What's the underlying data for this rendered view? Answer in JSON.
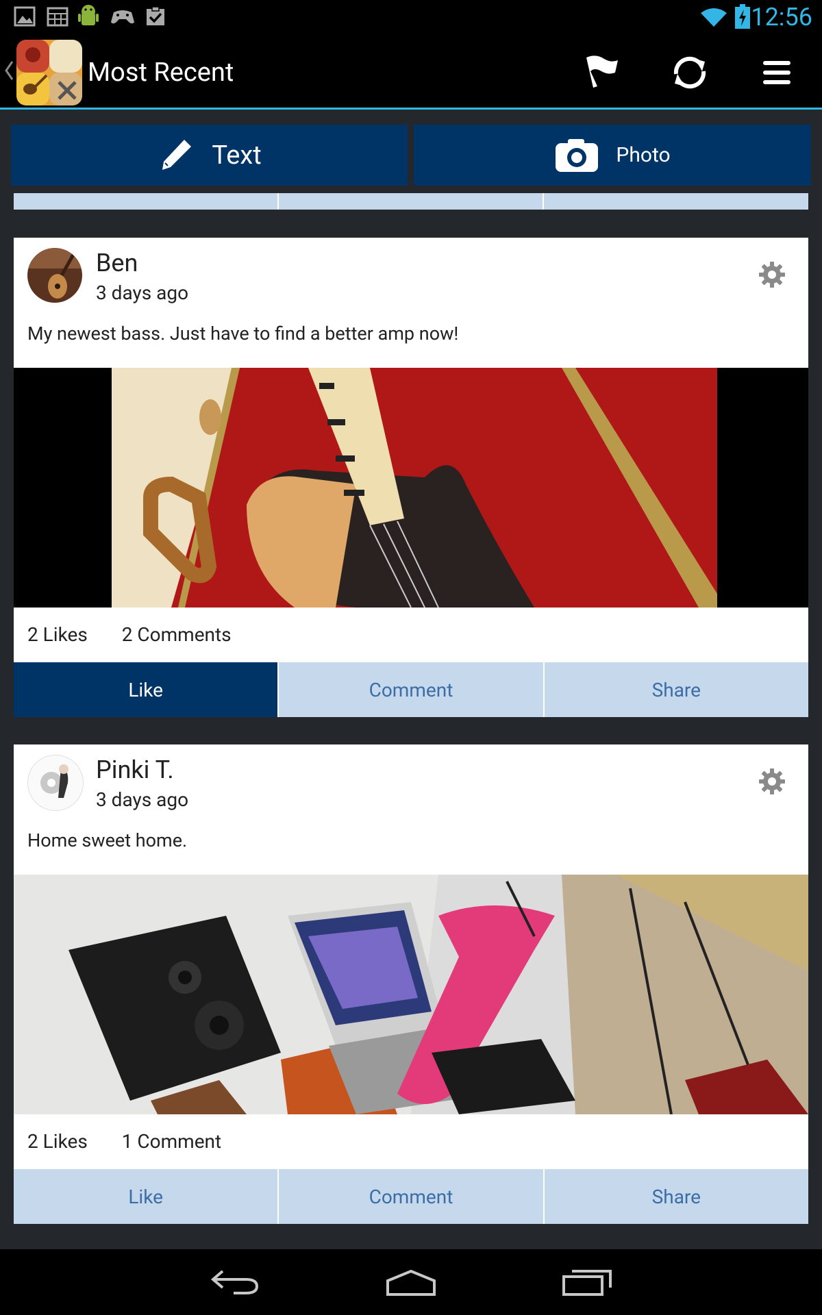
{
  "status_bar": {
    "time": "12:56",
    "notification_icons": [
      "image-icon",
      "calendar-icon",
      "android-icon",
      "gamepad-icon",
      "task-icon"
    ]
  },
  "action_bar": {
    "title": "Most Recent",
    "actions": [
      "flag-icon",
      "refresh-icon",
      "menu-icon"
    ]
  },
  "composer": {
    "text_label": "Text",
    "photo_label": "Photo"
  },
  "posts": [
    {
      "author": "Ben",
      "time": "3 days ago",
      "text": "My newest bass. Just have to find a better amp now!",
      "likes": "2 Likes",
      "comments": "2 Comments",
      "liked": true
    },
    {
      "author": "Pinki T.",
      "time": "3 days ago",
      "text": "Home sweet home.",
      "likes": "2 Likes",
      "comments": "1 Comment",
      "liked": false
    }
  ],
  "post_actions": {
    "like": "Like",
    "comment": "Comment",
    "share": "Share"
  },
  "colors": {
    "accent": "#33b5e5",
    "primary": "#003366",
    "action_bg": "#c5d8ec",
    "action_text": "#3d6da6"
  }
}
